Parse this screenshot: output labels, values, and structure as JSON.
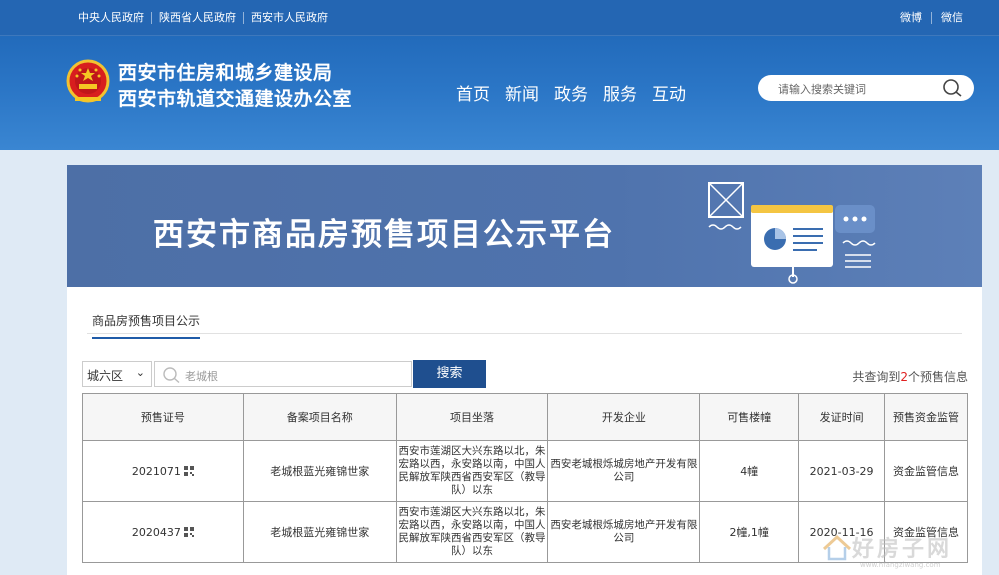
{
  "topbar": {
    "links": [
      "中央人民政府",
      "陕西省人民政府",
      "西安市人民政府"
    ],
    "social": [
      "微博",
      "微信"
    ]
  },
  "header": {
    "title_line1": "西安市住房和城乡建设局",
    "title_line2": "西安市轨道交通建设办公室",
    "nav": [
      "首页",
      "新闻",
      "政务",
      "服务",
      "互动"
    ],
    "search_placeholder": "请输入搜索关键词"
  },
  "banner": {
    "title": "西安市商品房预售项目公示平台"
  },
  "panel": {
    "tab_label": "商品房预售项目公示",
    "district_selected": "城六区",
    "keyword_value": "老城根",
    "search_button": "搜索",
    "result_prefix": "共查询到",
    "result_count": "2",
    "result_suffix": "个预售信息"
  },
  "table": {
    "headers": [
      "预售证号",
      "备案项目名称",
      "项目坐落",
      "开发企业",
      "可售楼幢",
      "发证时间",
      "预售资金监管"
    ],
    "rows": [
      {
        "cert_no": "2021071",
        "project": "老城根蓝光雍锦世家",
        "location": "西安市莲湖区大兴东路以北，朱宏路以西，永安路以南，中国人民解放军陕西省西安军区（教导队）以东",
        "developer": "西安老城根烁城房地产开发有限公司",
        "buildings": "4幢",
        "date": "2021-03-29",
        "fund": "资金监管信息"
      },
      {
        "cert_no": "2020437",
        "project": "老城根蓝光雍锦世家",
        "location": "西安市莲湖区大兴东路以北，朱宏路以西，永安路以南，中国人民解放军陕西省西安军区（教导队）以东",
        "developer": "西安老城根烁城房地产开发有限公司",
        "buildings": "2幢,1幢",
        "date": "2020-11-16",
        "fund": "资金监管信息"
      }
    ]
  },
  "watermark": {
    "text": "好房子网",
    "url": "www.hfangziwang.com"
  },
  "colors": {
    "header_blue": "#1c63b4",
    "banner_blue": "#4d6fa6",
    "button_navy": "#1f4f8f",
    "count_red": "#e02020"
  }
}
